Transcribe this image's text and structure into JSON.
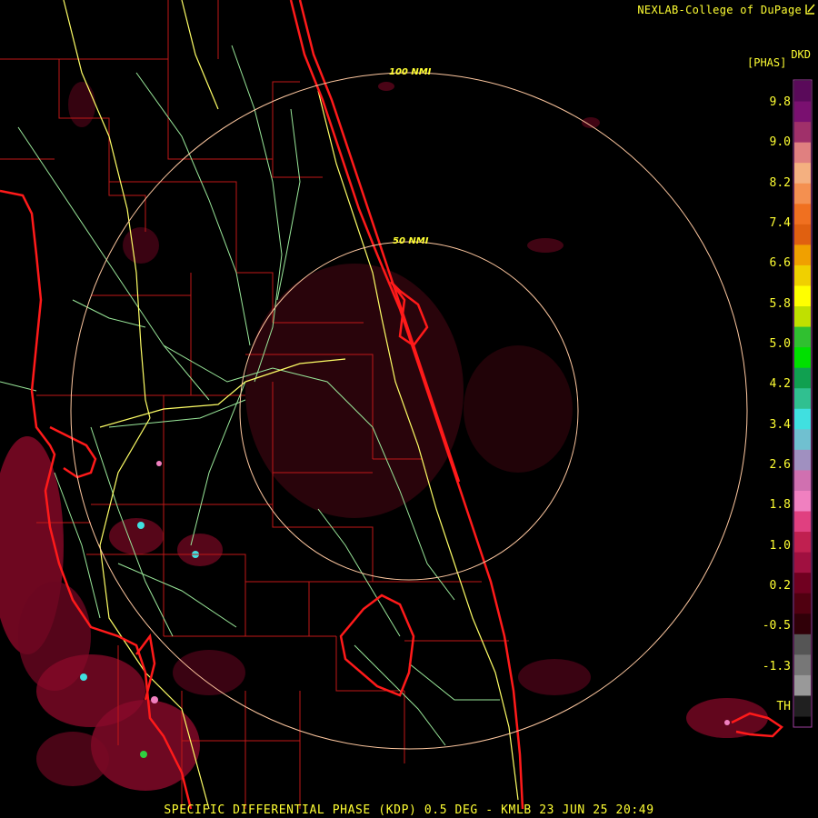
{
  "credit": "NEXLAB-College of DuPage",
  "product_code": "DKD",
  "product_unit": "[PHAS]",
  "range_rings": [
    "100 NMI",
    "50 NMI"
  ],
  "colorbar": {
    "ticks": [
      "9.8",
      "9.0",
      "8.2",
      "7.4",
      "6.6",
      "5.8",
      "5.0",
      "4.2",
      "3.4",
      "2.6",
      "1.8",
      "1.0",
      "0.2",
      "-0.5",
      "-1.3",
      "TH"
    ],
    "colors": [
      "#5a0a5a",
      "#7a1070",
      "#a0306a",
      "#e08080",
      "#f4b080",
      "#f49050",
      "#f07020",
      "#e06010",
      "#f0a000",
      "#f0d000",
      "#ffff00",
      "#c0e000",
      "#30c030",
      "#00e000",
      "#10a050",
      "#30c090",
      "#40e0e0",
      "#70c0d0",
      "#a090c0",
      "#d070b0",
      "#f080c0",
      "#e04080",
      "#c02050",
      "#a01040",
      "#700020",
      "#500010",
      "#300008",
      "#555555",
      "#777777",
      "#999999",
      "#202020"
    ]
  },
  "footer": "SPECIFIC DIFFERENTIAL PHASE (KDP) 0.5 DEG - KMLB 23 JUN 25 20:49",
  "colors": {
    "text": "#ffff33",
    "coast": "#ff1010",
    "county": "#c01818",
    "highway_major": "#ffff66",
    "highway_minor": "#a0f0a0",
    "ring": "#ffc8a0",
    "echo": "#8a0a28"
  }
}
